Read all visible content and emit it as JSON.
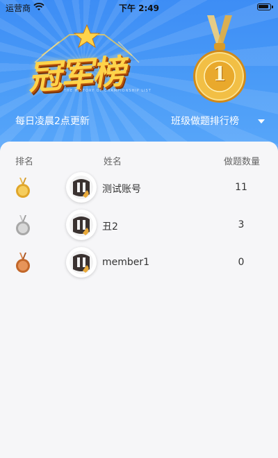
{
  "status_bar": {
    "carrier": "运营商",
    "time": "下午 2:49"
  },
  "header": {
    "title_art_text": "冠军榜",
    "title_art_subtitle": "THE HISTORY OF CHAMPIONSHIP LIST",
    "medal_number": "1",
    "update_note": "每日凌晨2点更新",
    "board_select": "班级做题排行榜"
  },
  "table": {
    "headers": {
      "rank": "排名",
      "name": "姓名",
      "count": "做题数量"
    },
    "rows": [
      {
        "name": "测试账号",
        "count": "11",
        "medal": "gold-medal-icon",
        "medal_color": "#e0a62a"
      },
      {
        "name": "丑2",
        "count": "3",
        "medal": "silver-medal-icon",
        "medal_color": "#a8a8a8"
      },
      {
        "name": "member1",
        "count": "0",
        "medal": "bronze-medal-icon",
        "medal_color": "#c2672a"
      }
    ]
  },
  "colors": {
    "banner": "#3d8df5",
    "card": "#f6f6f8",
    "gold": "#e8a92a"
  }
}
